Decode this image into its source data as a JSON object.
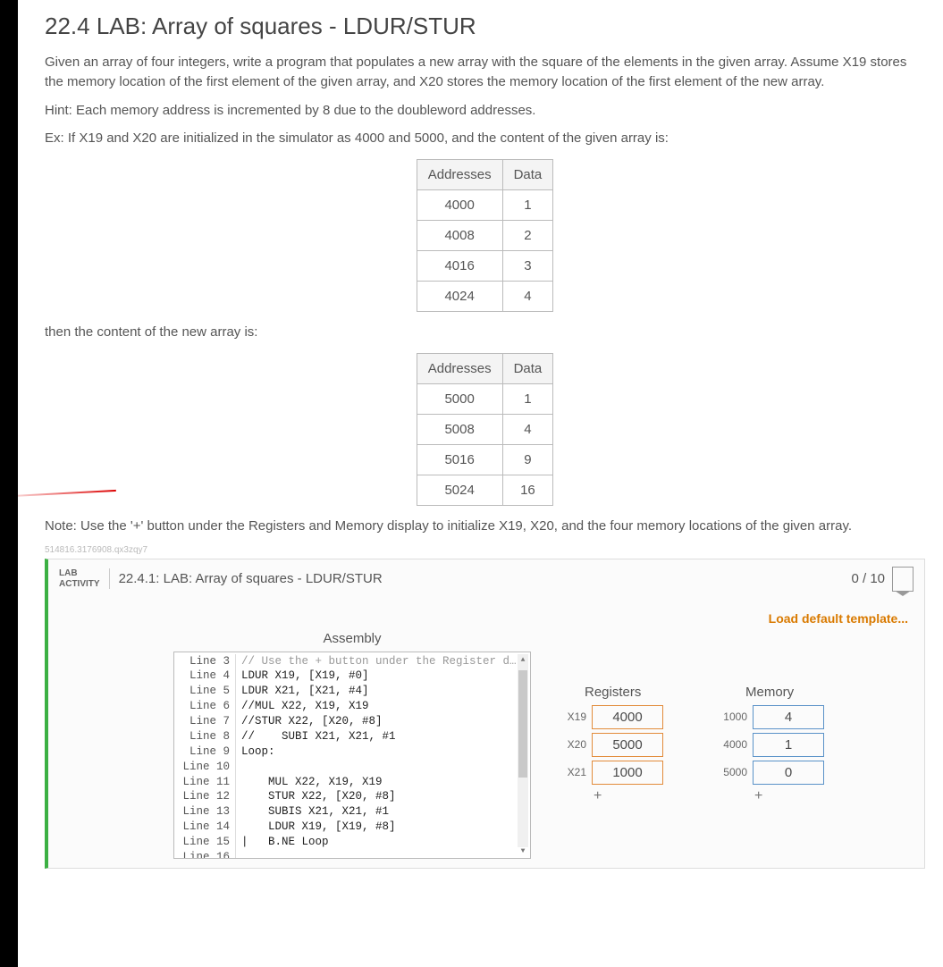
{
  "header": {
    "title": "22.4 LAB: Array of squares - LDUR/STUR"
  },
  "body": {
    "p1": "Given an array of four integers, write a program that populates a new array with the square of the elements in the given array. Assume X19 stores the memory location of the first element of the given array, and X20 stores the memory location of the first element of the new array.",
    "p2": "Hint: Each memory address is incremented by 8 due to the doubleword addresses.",
    "p3": "Ex: If X19 and X20 are initialized in the simulator as 4000 and 5000, and the content of the given array is:",
    "p4": "then the content of the new array is:",
    "p5": "Note: Use the '+' button under the Registers and Memory display to initialize X19, X20, and the four memory locations of the given array.",
    "hash": "514816.3176908.qx3zqy7"
  },
  "table1": {
    "h1": "Addresses",
    "h2": "Data",
    "rows": [
      {
        "a": "4000",
        "d": "1"
      },
      {
        "a": "4008",
        "d": "2"
      },
      {
        "a": "4016",
        "d": "3"
      },
      {
        "a": "4024",
        "d": "4"
      }
    ]
  },
  "table2": {
    "h1": "Addresses",
    "h2": "Data",
    "rows": [
      {
        "a": "5000",
        "d": "1"
      },
      {
        "a": "5008",
        "d": "4"
      },
      {
        "a": "5016",
        "d": "9"
      },
      {
        "a": "5024",
        "d": "16"
      }
    ]
  },
  "lab": {
    "tag_l1": "LAB",
    "tag_l2": "ACTIVITY",
    "title": "22.4.1: LAB: Array of squares - LDUR/STUR",
    "score": "0 / 10",
    "load_template": "Load default template..."
  },
  "sim": {
    "asm_header": "Assembly",
    "lines": [
      {
        "n": "Line 3",
        "c": "// Use the + button under the Register d…",
        "cut": true
      },
      {
        "n": "Line 4",
        "c": "LDUR X19, [X19, #0]"
      },
      {
        "n": "Line 5",
        "c": "LDUR X21, [X21, #4]"
      },
      {
        "n": "Line 6",
        "c": "//MUL X22, X19, X19"
      },
      {
        "n": "Line 7",
        "c": "//STUR X22, [X20, #8]"
      },
      {
        "n": "Line 8",
        "c": "//    SUBI X21, X21, #1"
      },
      {
        "n": "Line 9",
        "c": "Loop:"
      },
      {
        "n": "Line 10",
        "c": ""
      },
      {
        "n": "Line 11",
        "c": "    MUL X22, X19, X19"
      },
      {
        "n": "Line 12",
        "c": "    STUR X22, [X20, #8]"
      },
      {
        "n": "Line 13",
        "c": "    SUBIS X21, X21, #1"
      },
      {
        "n": "Line 14",
        "c": "    LDUR X19, [X19, #8]"
      },
      {
        "n": "Line 15",
        "c": "|   B.NE Loop"
      },
      {
        "n": "Line 16",
        "c": ""
      }
    ],
    "regs_header": "Registers",
    "regs": [
      {
        "lbl": "X19",
        "val": "4000"
      },
      {
        "lbl": "X20",
        "val": "5000"
      },
      {
        "lbl": "X21",
        "val": "1000"
      }
    ],
    "mem_header": "Memory",
    "mem": [
      {
        "lbl": "1000",
        "val": "4"
      },
      {
        "lbl": "4000",
        "val": "1"
      },
      {
        "lbl": "5000",
        "val": "0"
      }
    ],
    "plus": "+"
  }
}
